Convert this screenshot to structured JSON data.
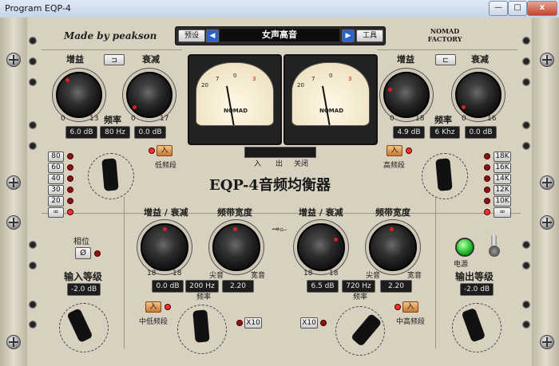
{
  "window": {
    "title": "Program EQP-4",
    "min_label": "—",
    "max_label": "□",
    "close_label": "x"
  },
  "header": {
    "brand": "Made by peakson",
    "preset_label": "预设",
    "preset_name": "女声高音",
    "tools_label": "工具",
    "logo": "NOMAD FACTORY",
    "prev_icon": "triangle-left-icon",
    "next_icon": "triangle-right-icon"
  },
  "product_name": "EQP-4音频均衡器",
  "meters": {
    "switch_labels": [
      "入",
      "出",
      "关闭"
    ],
    "scale_labels": [
      "20",
      "10",
      "7",
      "5",
      "3",
      "1",
      "0",
      "1",
      "2",
      "3"
    ],
    "logo": "NOMAD"
  },
  "low_band": {
    "boost_label": "增益",
    "atten_label": "衰减",
    "freq_label": "频率",
    "boost_min": "0",
    "boost_max": "13",
    "atten_min": "0",
    "atten_max": "17",
    "boost_value": "6.0 dB",
    "freq_value": "80 Hz",
    "atten_value": "0.0 dB",
    "shape_icon": "low-shelf-icon",
    "enable_label": "入",
    "section_label": "低频段",
    "freq_options": [
      "80",
      "60",
      "40",
      "30",
      "20",
      "∞"
    ]
  },
  "high_band": {
    "boost_label": "增益",
    "atten_label": "衰减",
    "freq_label": "频率",
    "boost_min": "0",
    "boost_max": "18",
    "atten_min": "0",
    "atten_max": "16",
    "boost_value": "4.9 dB",
    "freq_value": "6 Khz",
    "atten_value": "0.0 dB",
    "shape_icon": "high-shelf-icon",
    "enable_label": "入",
    "section_label": "高频段",
    "freq_options": [
      "18K",
      "16K",
      "14K",
      "12K",
      "10K",
      "∞"
    ]
  },
  "input": {
    "phase_label": "相位",
    "phase_button": "Ø",
    "level_label": "输入等级",
    "level_value": "-2.0 dB"
  },
  "mid_low": {
    "gain_label": "增益 / 衰减",
    "bw_label": "频带宽度",
    "freq_label": "频率",
    "gain_min": "18",
    "gain_max": "18",
    "bw_left": "尖音",
    "bw_right": "宽音",
    "gain_value": "0.0 dB",
    "freq_value": "200 Hz",
    "bw_value": "2.20",
    "enable_label": "入",
    "section_label": "中低频段",
    "x10_label": "X10"
  },
  "mid_high": {
    "gain_label": "增益 / 衰减",
    "bw_label": "频带宽度",
    "freq_label": "频率",
    "gain_min": "18",
    "gain_max": "18",
    "bw_left": "尖音",
    "bw_right": "宽音",
    "gain_value": "6.5 dB",
    "freq_value": "720 Hz",
    "bw_value": "2.20",
    "enable_label": "入",
    "section_label": "中高频段",
    "x10_label": "X10"
  },
  "output": {
    "power_label": "电源",
    "level_label": "输出等级",
    "level_value": "-2.0 dB"
  },
  "colors": {
    "panel": "#d8d1bf",
    "lcd": "#1d1d1d",
    "led_on": "#ff3030",
    "power_led": "#22c02a",
    "accent_orange": "#c9782e"
  }
}
